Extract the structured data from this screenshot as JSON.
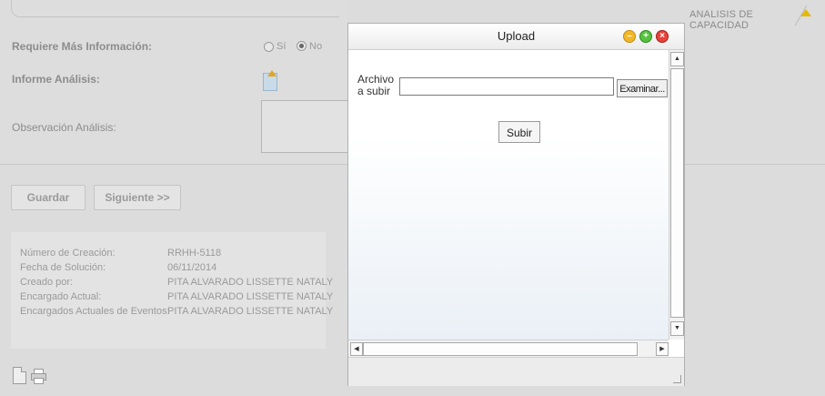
{
  "header": {
    "tab_label": "ANALISIS DE CAPACIDAD"
  },
  "form": {
    "requiere_label": "Requiere Más Información:",
    "radio_si": "Sí",
    "radio_no": "No",
    "radio_selected": "No",
    "informe_label": "Informe Análisis:",
    "observacion_label": "Observación Análisis:"
  },
  "actions": {
    "guardar": "Guardar",
    "siguiente": "Siguiente >>"
  },
  "info": {
    "rows": [
      {
        "label": "Número de Creación:",
        "value": "RRHH-5118"
      },
      {
        "label": "Fecha de Solución:",
        "value": "06/11/2014"
      },
      {
        "label": "Creado por:",
        "value": "PITA ALVARADO LISSETTE NATALY"
      },
      {
        "label": "Encargado Actual:",
        "value": "PITA ALVARADO LISSETTE NATALY"
      },
      {
        "label": "Encargados Actuales de Eventos:",
        "value": "PITA ALVARADO LISSETTE NATALY"
      }
    ]
  },
  "upload_window": {
    "title": "Upload",
    "file_label": "Archivo a subir",
    "file_value": "",
    "browse": "Examinar...",
    "submit": "Subir"
  },
  "colors": {
    "minimize": "#f2b82a",
    "maximize": "#57c23f",
    "close": "#e9423a",
    "tab_arrow": "#e5b800"
  }
}
